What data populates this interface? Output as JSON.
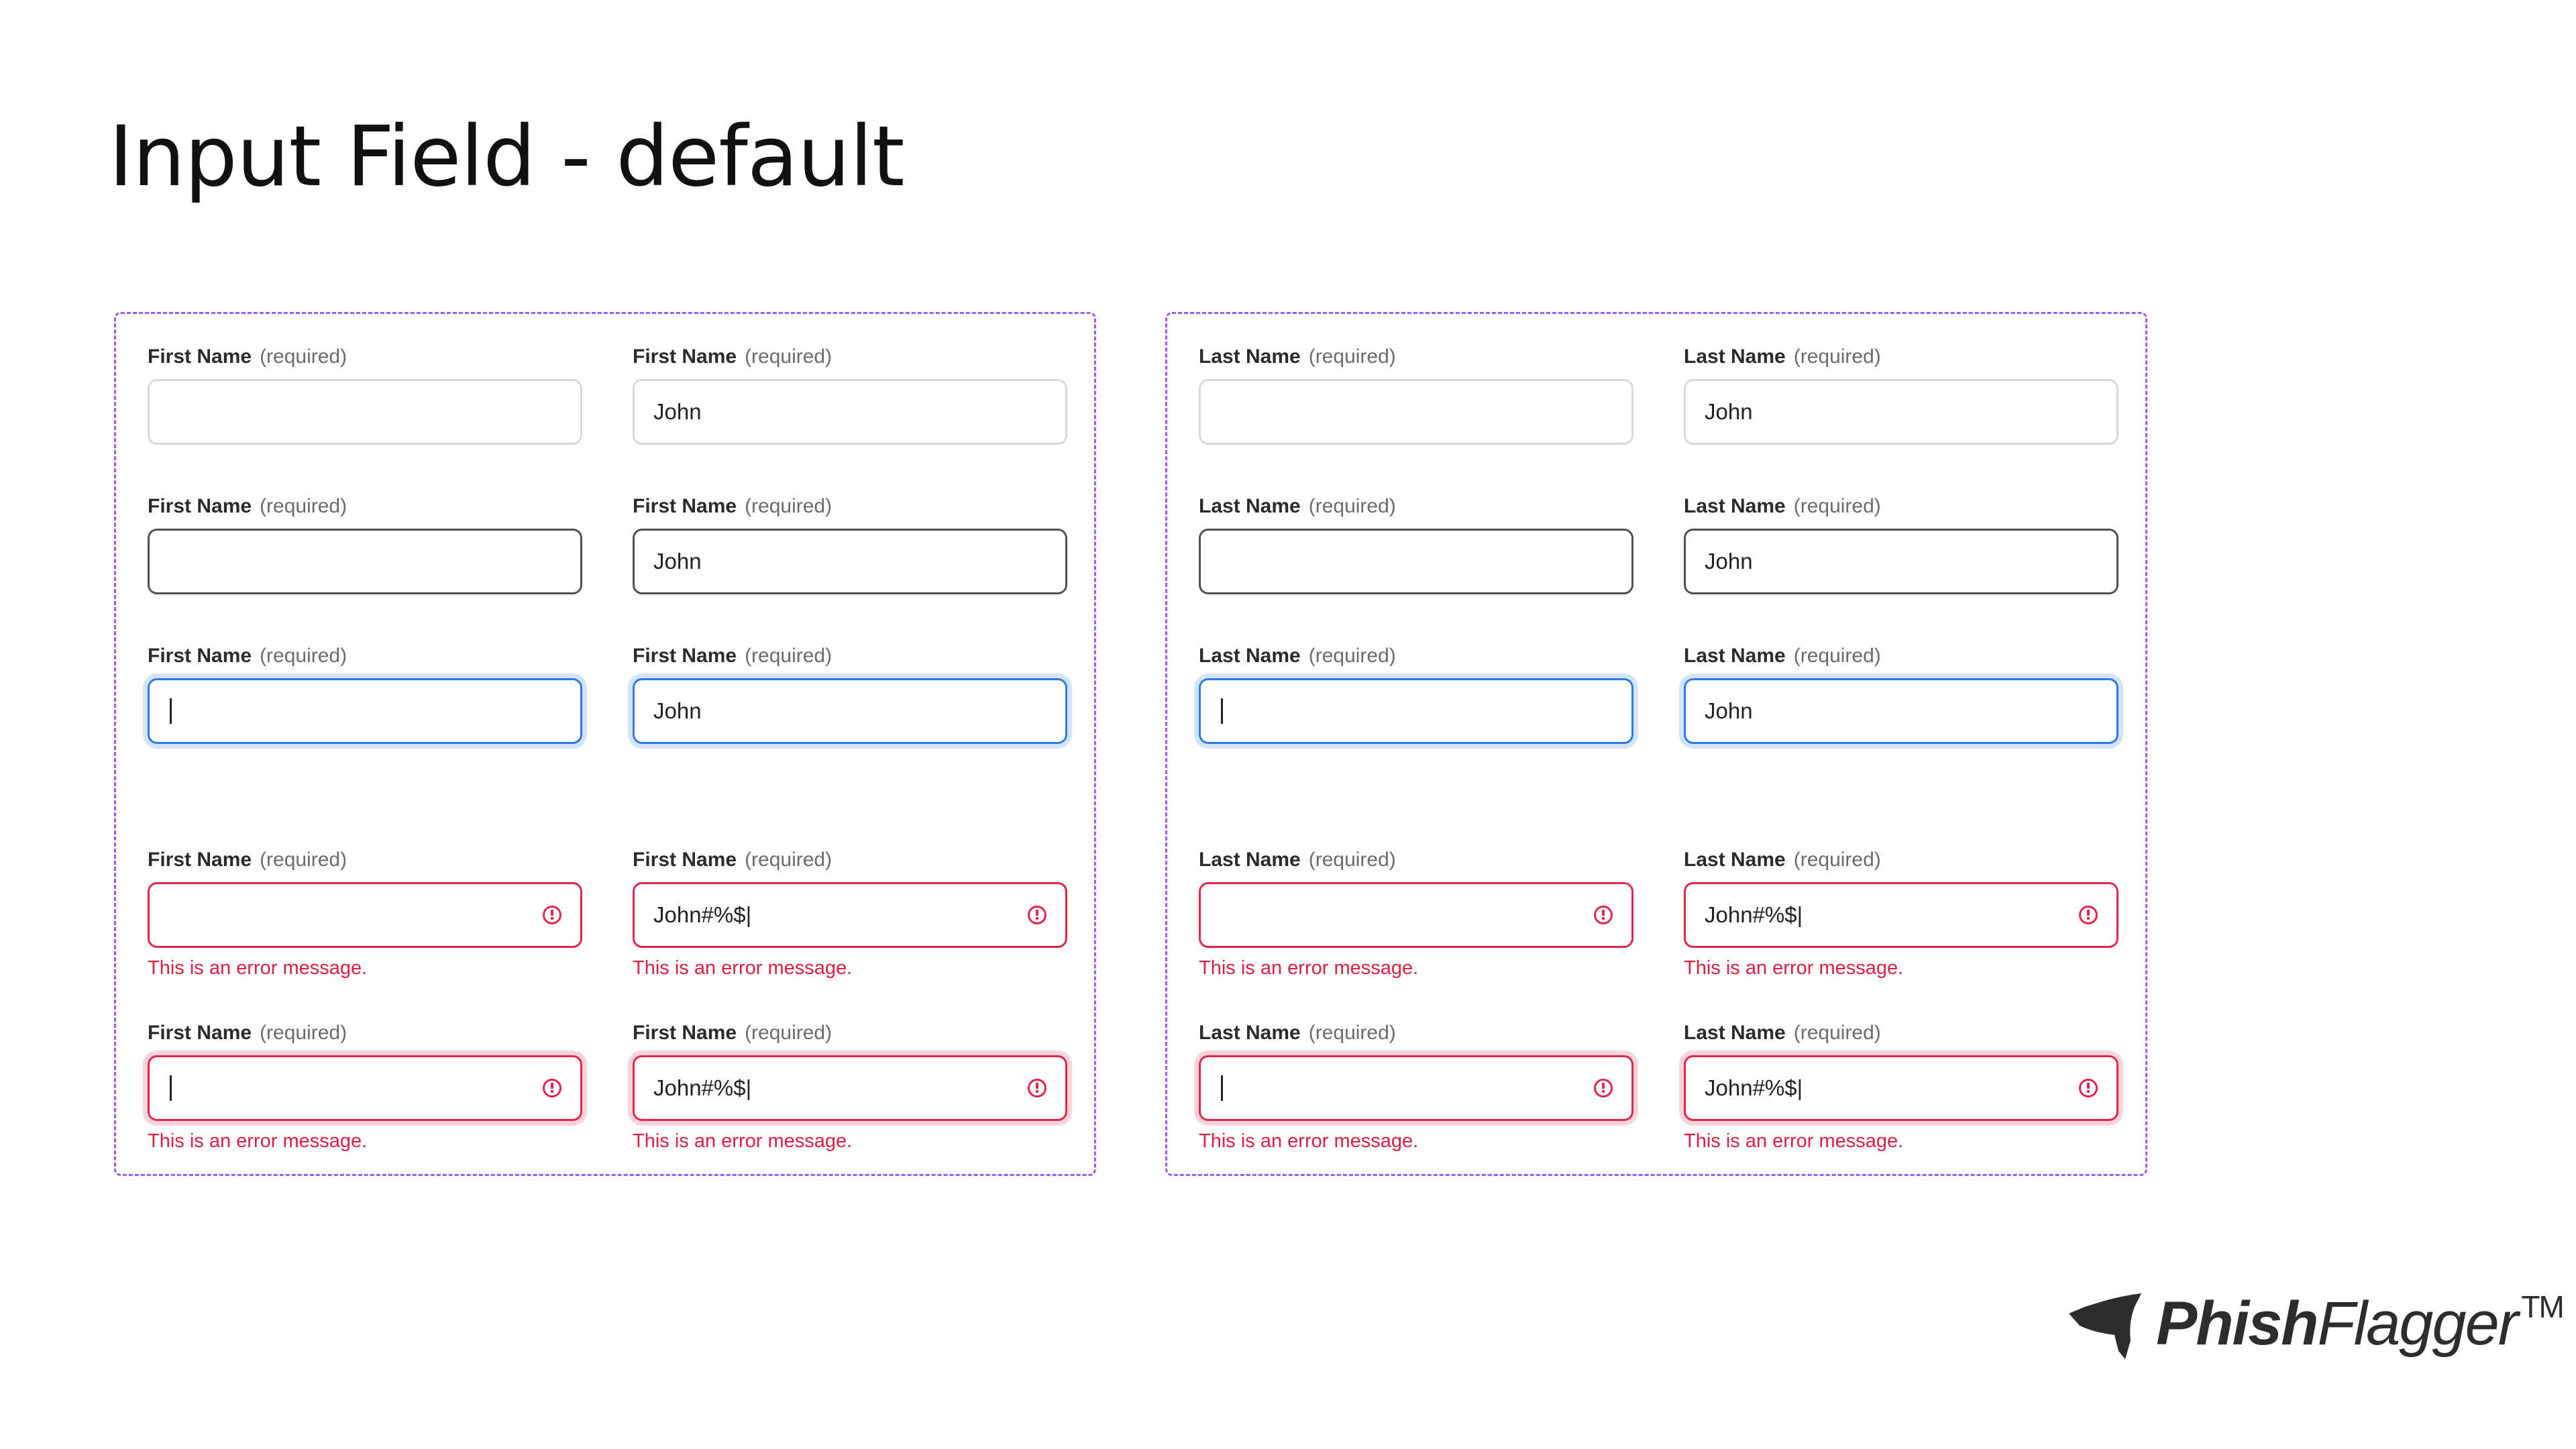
{
  "page_title": "Input Field - default",
  "groups": [
    {
      "label_name": "First Name",
      "required_text": "(required)",
      "rows": [
        {
          "state": "default",
          "fields": [
            {
              "value": ""
            },
            {
              "value": "John"
            }
          ]
        },
        {
          "state": "hover",
          "fields": [
            {
              "value": ""
            },
            {
              "value": "John"
            }
          ]
        },
        {
          "state": "focus",
          "fields": [
            {
              "value": ""
            },
            {
              "value": "John"
            }
          ]
        },
        {
          "state": "error",
          "fields": [
            {
              "value": "",
              "error": "This is an error message."
            },
            {
              "value": "John#%$|",
              "error": "This is an error message."
            }
          ]
        },
        {
          "state": "error-focus",
          "fields": [
            {
              "value": "",
              "error": "This is an error message."
            },
            {
              "value": "John#%$|",
              "error": "This is an error message."
            }
          ]
        }
      ]
    },
    {
      "label_name": "Last Name",
      "required_text": "(required)",
      "rows": [
        {
          "state": "default",
          "fields": [
            {
              "value": ""
            },
            {
              "value": "John"
            }
          ]
        },
        {
          "state": "hover",
          "fields": [
            {
              "value": ""
            },
            {
              "value": "John"
            }
          ]
        },
        {
          "state": "focus",
          "fields": [
            {
              "value": ""
            },
            {
              "value": "John"
            }
          ]
        },
        {
          "state": "error",
          "fields": [
            {
              "value": "",
              "error": "This is an error message."
            },
            {
              "value": "John#%$|",
              "error": "This is an error message."
            }
          ]
        },
        {
          "state": "error-focus",
          "fields": [
            {
              "value": "",
              "error": "This is an error message."
            },
            {
              "value": "John#%$|",
              "error": "This is an error message."
            }
          ]
        }
      ]
    }
  ],
  "logo": {
    "text_bold": "Phish",
    "text_light": "Flagger",
    "trademark": "TM"
  },
  "colors": {
    "frame_dashed": "#9b5cf4",
    "focus_border": "#2f7ae5",
    "error": "#e0264a",
    "default_border": "#d9d9d9",
    "hover_border": "#505050"
  }
}
